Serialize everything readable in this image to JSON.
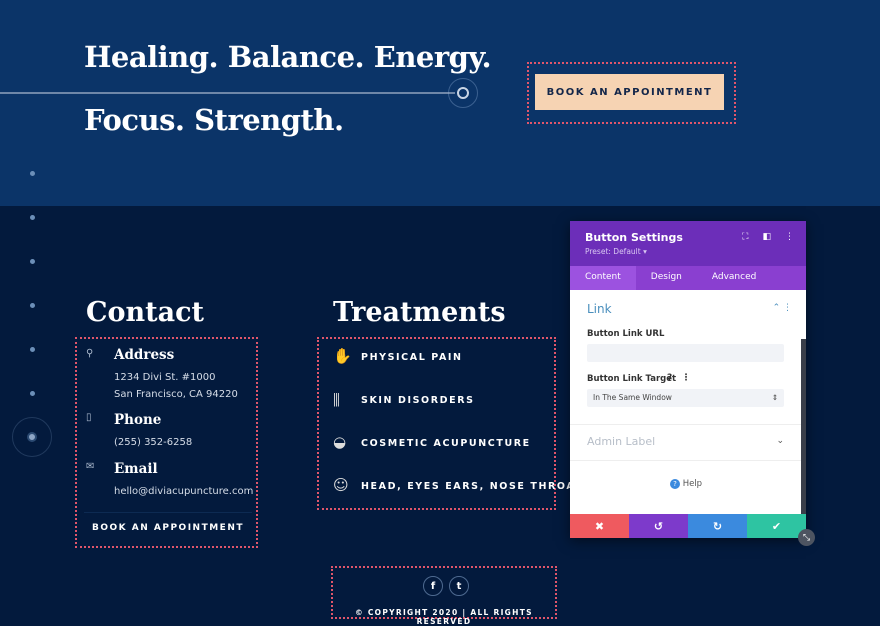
{
  "hero": {
    "line1": "Healing. Balance. Energy.",
    "line2": "Focus. Strength.",
    "button": "BOOK AN APPOINTMENT"
  },
  "contact": {
    "title": "Contact",
    "items": [
      {
        "icon": "map-pin-icon",
        "label": "Address",
        "lines": [
          "1234 Divi St. #1000",
          "San Francisco, CA 94220"
        ]
      },
      {
        "icon": "phone-icon",
        "label": "Phone",
        "lines": [
          "(255) 352-6258"
        ]
      },
      {
        "icon": "email-icon",
        "label": "Email",
        "lines": [
          "hello@diviacupuncture.com"
        ]
      }
    ],
    "button": "BOOK AN APPOINTMENT"
  },
  "treatments": {
    "title": "Treatments",
    "items": [
      "PHYSICAL PAIN",
      "SKIN DISORDERS",
      "COSMETIC ACUPUNCTURE",
      "HEAD, EYES EARS, NOSE THROAT"
    ]
  },
  "footer": {
    "copyright": "© COPYRIGHT 2020 | ALL RIGHTS RESERVED",
    "social": [
      "facebook-icon",
      "twitter-icon"
    ]
  },
  "panel": {
    "title": "Button Settings",
    "preset": "Preset: Default ▾",
    "tabs": [
      "Content",
      "Design",
      "Advanced"
    ],
    "active_tab": "Content",
    "section": "Link",
    "url_label": "Button Link URL",
    "url_value": "",
    "target_label": "Button Link Target",
    "target_value": "In The Same Window",
    "admin_label": "Admin Label",
    "help": "Help"
  },
  "colors": {
    "hero_bg": "#0b3468",
    "page_bg": "#031a3d",
    "accent": "#f6d3b3",
    "panel_header": "#6c2eb9",
    "cancel": "#ef5a5f",
    "undo": "#7d3acb",
    "redo": "#3b8ade",
    "save": "#2ec4a2"
  }
}
